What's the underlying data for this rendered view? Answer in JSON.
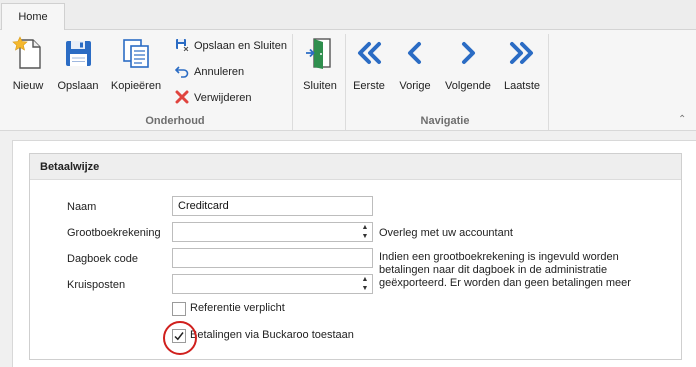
{
  "ribbon": {
    "tab_home": "Home",
    "buttons": {
      "nieuw": "Nieuw",
      "opslaan": "Opslaan",
      "kopieren": "Kopieëren",
      "opslaan_sluiten": "Opslaan en Sluiten",
      "annuleren": "Annuleren",
      "verwijderen": "Verwijderen",
      "sluiten": "Sluiten",
      "eerste": "Eerste",
      "vorige": "Vorige",
      "volgende": "Volgende",
      "laatste": "Laatste"
    },
    "groups": {
      "onderhoud": "Onderhoud",
      "navigatie": "Navigatie"
    },
    "colors": {
      "icon_blue": "#2b6cc4",
      "delete_red": "#e0443e",
      "exit_green": "#2f8f4e"
    }
  },
  "form": {
    "section_title": "Betaalwijze",
    "fields": {
      "naam_label": "Naam",
      "naam_value": "Creditcard",
      "grootboek_label": "Grootboekrekening",
      "grootboek_value": "",
      "dagboek_label": "Dagboek code",
      "dagboek_value": "",
      "kruisposten_label": "Kruisposten",
      "kruisposten_value": ""
    },
    "notes": {
      "overleg": "Overleg met uw accountant",
      "dagboek_line1": "Indien een grootboekrekening is ingevuld worden",
      "dagboek_line2": "betalingen naar dit dagboek in de administratie",
      "dagboek_line3": "geëxporteerd. Er worden dan geen betalingen meer"
    },
    "checkboxes": {
      "referentie_label": "Referentie verplicht",
      "referentie_checked": false,
      "buckaroo_label": "Betalingen via Buckaroo toestaan",
      "buckaroo_checked": true
    },
    "highlight_color": "#d0201d"
  }
}
